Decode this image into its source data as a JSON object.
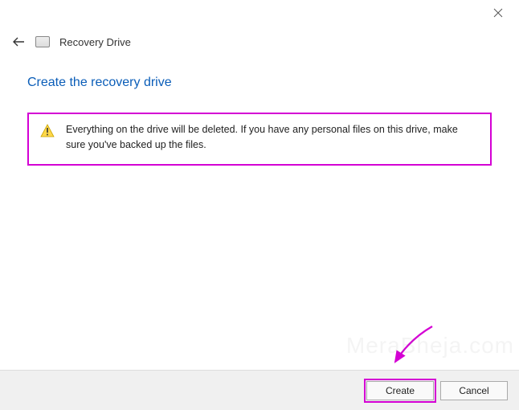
{
  "window": {
    "title": "Recovery Drive"
  },
  "heading": "Create the recovery drive",
  "warning": {
    "text": "Everything on the drive will be deleted. If you have any personal files on this drive, make sure you've backed up the files."
  },
  "buttons": {
    "create": "Create",
    "cancel": "Cancel"
  },
  "annotation": {
    "highlight_color": "#d400d4"
  }
}
